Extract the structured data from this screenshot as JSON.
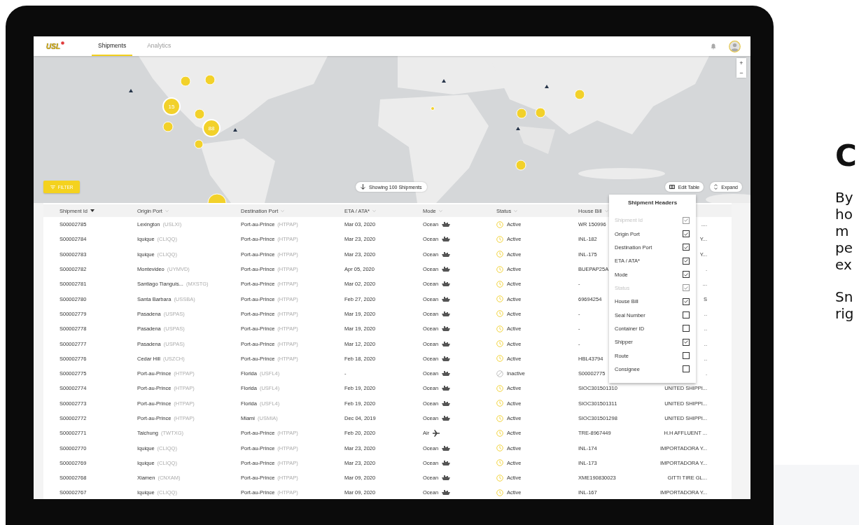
{
  "app": {
    "logo": "USL"
  },
  "tabs": [
    {
      "label": "Shipments",
      "selected": true
    },
    {
      "label": "Analytics",
      "selected": false
    }
  ],
  "map": {
    "kind": "picture",
    "clusters": [
      {
        "label": "15"
      },
      {
        "label": "88"
      }
    ],
    "zoom_controls": [
      "+",
      "−"
    ],
    "filter_button": "FILTER",
    "shipments_pill": "Showing 100 Shipments",
    "edit_table_button": "Edit Table",
    "expand_button": "Expand"
  },
  "table": {
    "columns": [
      {
        "label": "Shipment Id",
        "sorted": true
      },
      {
        "label": "Origin Port",
        "sorted": false
      },
      {
        "label": "Destination Port",
        "sorted": false
      },
      {
        "label": "ETA / ATA*",
        "sorted": false
      },
      {
        "label": "Mode",
        "sorted": false
      },
      {
        "label": "Status",
        "sorted": false
      },
      {
        "label": "House Bill",
        "sorted": false
      }
    ],
    "rows": [
      {
        "id": "S00002785",
        "origin": "Lexington",
        "origin_code": "(USLXI)",
        "destination": "Port-au-Prince",
        "destination_code": "(HTPAP)",
        "eta": "Mar 03, 2020",
        "mode": {
          "label": "Ocean",
          "kind": "ship"
        },
        "status": {
          "label": "Active",
          "kind": "active"
        },
        "house_bill": "WR 150996",
        "column_8": "...."
      },
      {
        "id": "S00002784",
        "origin": "Iquique",
        "origin_code": "(CLIQQ)",
        "destination": "Port-au-Prince",
        "destination_code": "(HTPAP)",
        "eta": "Mar 23, 2020",
        "mode": {
          "label": "Ocean",
          "kind": "ship"
        },
        "status": {
          "label": "Active",
          "kind": "active"
        },
        "house_bill": "INL-182",
        "column_8": "Y..."
      },
      {
        "id": "S00002783",
        "origin": "Iquique",
        "origin_code": "(CLIQQ)",
        "destination": "Port-au-Prince",
        "destination_code": "(HTPAP)",
        "eta": "Mar 23, 2020",
        "mode": {
          "label": "Ocean",
          "kind": "ship"
        },
        "status": {
          "label": "Active",
          "kind": "active"
        },
        "house_bill": "INL-175",
        "column_8": "Y..."
      },
      {
        "id": "S00002782",
        "origin": "Montevideo",
        "origin_code": "(UYMVD)",
        "destination": "Port-au-Prince",
        "destination_code": "(HTPAP)",
        "eta": "Apr 05, 2020",
        "mode": {
          "label": "Ocean",
          "kind": "ship"
        },
        "status": {
          "label": "Active",
          "kind": "active"
        },
        "house_bill": "BUEPAP25A",
        "column_8": "."
      },
      {
        "id": "S00002781",
        "origin": "Santiago Tianguis...",
        "origin_code": "(MXSTG)",
        "destination": "Port-au-Prince",
        "destination_code": "(HTPAP)",
        "eta": "Mar 02, 2020",
        "mode": {
          "label": "Ocean",
          "kind": "ship"
        },
        "status": {
          "label": "Active",
          "kind": "active"
        },
        "house_bill": "-",
        "column_8": "..."
      },
      {
        "id": "S00002780",
        "origin": "Santa Barbara",
        "origin_code": "(USSBA)",
        "destination": "Port-au-Prince",
        "destination_code": "(HTPAP)",
        "eta": "Feb 27, 2020",
        "mode": {
          "label": "Ocean",
          "kind": "ship"
        },
        "status": {
          "label": "Active",
          "kind": "active"
        },
        "house_bill": "69694254",
        "column_8": "S"
      },
      {
        "id": "S00002779",
        "origin": "Pasadena",
        "origin_code": "(USPAS)",
        "destination": "Port-au-Prince",
        "destination_code": "(HTPAP)",
        "eta": "Mar 19, 2020",
        "mode": {
          "label": "Ocean",
          "kind": "ship"
        },
        "status": {
          "label": "Active",
          "kind": "active"
        },
        "house_bill": "-",
        "column_8": ".."
      },
      {
        "id": "S00002778",
        "origin": "Pasadena",
        "origin_code": "(USPAS)",
        "destination": "Port-au-Prince",
        "destination_code": "(HTPAP)",
        "eta": "Mar 19, 2020",
        "mode": {
          "label": "Ocean",
          "kind": "ship"
        },
        "status": {
          "label": "Active",
          "kind": "active"
        },
        "house_bill": "-",
        "column_8": ".."
      },
      {
        "id": "S00002777",
        "origin": "Pasadena",
        "origin_code": "(USPAS)",
        "destination": "Port-au-Prince",
        "destination_code": "(HTPAP)",
        "eta": "Mar 12, 2020",
        "mode": {
          "label": "Ocean",
          "kind": "ship"
        },
        "status": {
          "label": "Active",
          "kind": "active"
        },
        "house_bill": "-",
        "column_8": ".."
      },
      {
        "id": "S00002776",
        "origin": "Cedar Hill",
        "origin_code": "(USZCH)",
        "destination": "Port-au-Prince",
        "destination_code": "(HTPAP)",
        "eta": "Feb 18, 2020",
        "mode": {
          "label": "Ocean",
          "kind": "ship"
        },
        "status": {
          "label": "Active",
          "kind": "active"
        },
        "house_bill": "HBL43794",
        "column_8": ".."
      },
      {
        "id": "S00002775",
        "origin": "Port-au-Prince",
        "origin_code": "(HTPAP)",
        "destination": "Florida",
        "destination_code": "(USFL4)",
        "eta": "-",
        "mode": {
          "label": "Ocean",
          "kind": "ship"
        },
        "status": {
          "label": "Inactive",
          "kind": "inactive"
        },
        "house_bill": "S00002775",
        "column_8": "."
      },
      {
        "id": "S00002774",
        "origin": "Port-au-Prince",
        "origin_code": "(HTPAP)",
        "destination": "Florida",
        "destination_code": "(USFL4)",
        "eta": "Feb 19, 2020",
        "mode": {
          "label": "Ocean",
          "kind": "ship"
        },
        "status": {
          "label": "Active",
          "kind": "active"
        },
        "house_bill": "SIOC301501310",
        "column_8": "UNITED SHIPPI..."
      },
      {
        "id": "S00002773",
        "origin": "Port-au-Prince",
        "origin_code": "(HTPAP)",
        "destination": "Florida",
        "destination_code": "(USFL4)",
        "eta": "Feb 19, 2020",
        "mode": {
          "label": "Ocean",
          "kind": "ship"
        },
        "status": {
          "label": "Active",
          "kind": "active"
        },
        "house_bill": "SIOC301501311",
        "column_8": "UNITED SHIPPI..."
      },
      {
        "id": "S00002772",
        "origin": "Port-au-Prince",
        "origin_code": "(HTPAP)",
        "destination": "Miami",
        "destination_code": "(USMIA)",
        "eta": "Dec 04, 2019",
        "mode": {
          "label": "Ocean",
          "kind": "ship"
        },
        "status": {
          "label": "Active",
          "kind": "active"
        },
        "house_bill": "SIOC301501298",
        "column_8": "UNITED SHIPPI..."
      },
      {
        "id": "S00002771",
        "origin": "Taichung",
        "origin_code": "(TWTXG)",
        "destination": "Port-au-Prince",
        "destination_code": "(HTPAP)",
        "eta": "Feb 20, 2020",
        "mode": {
          "label": "Air",
          "kind": "plane"
        },
        "status": {
          "label": "Active",
          "kind": "active"
        },
        "house_bill": "TRE-8967449",
        "column_8": "H.H AFFLUENT ..."
      },
      {
        "id": "S00002770",
        "origin": "Iquique",
        "origin_code": "(CLIQQ)",
        "destination": "Port-au-Prince",
        "destination_code": "(HTPAP)",
        "eta": "Mar 23, 2020",
        "mode": {
          "label": "Ocean",
          "kind": "ship"
        },
        "status": {
          "label": "Active",
          "kind": "active"
        },
        "house_bill": "INL-174",
        "column_8": "IMPORTADORA Y..."
      },
      {
        "id": "S00002769",
        "origin": "Iquique",
        "origin_code": "(CLIQQ)",
        "destination": "Port-au-Prince",
        "destination_code": "(HTPAP)",
        "eta": "Mar 23, 2020",
        "mode": {
          "label": "Ocean",
          "kind": "ship"
        },
        "status": {
          "label": "Active",
          "kind": "active"
        },
        "house_bill": "INL-173",
        "column_8": "IMPORTADORA Y..."
      },
      {
        "id": "S00002768",
        "origin": "Xiamen",
        "origin_code": "(CNXAM)",
        "destination": "Port-au-Prince",
        "destination_code": "(HTPAP)",
        "eta": "Mar 09, 2020",
        "mode": {
          "label": "Ocean",
          "kind": "ship"
        },
        "status": {
          "label": "Active",
          "kind": "active"
        },
        "house_bill": "XME190830023",
        "column_8": "GITTI TIRE GL..."
      },
      {
        "id": "S00002767",
        "origin": "Iquique",
        "origin_code": "(CLIQQ)",
        "destination": "Port-au-Prince",
        "destination_code": "(HTPAP)",
        "eta": "Mar 09, 2020",
        "mode": {
          "label": "Ocean",
          "kind": "ship"
        },
        "status": {
          "label": "Active",
          "kind": "active"
        },
        "house_bill": "INL-167",
        "column_8": "IMPORTADORA Y..."
      }
    ]
  },
  "headers_menu": {
    "title": "Shipment Headers",
    "items": [
      {
        "label": "Shipment Id",
        "checked": true,
        "disabled": true
      },
      {
        "label": "Origin Port",
        "checked": true,
        "disabled": false
      },
      {
        "label": "Destination Port",
        "checked": true,
        "disabled": false
      },
      {
        "label": "ETA / ATA*",
        "checked": true,
        "disabled": false
      },
      {
        "label": "Mode",
        "checked": true,
        "disabled": false
      },
      {
        "label": "Status",
        "checked": true,
        "disabled": true
      },
      {
        "label": "House Bill",
        "checked": true,
        "disabled": false
      },
      {
        "label": "Seal Number",
        "checked": false,
        "disabled": false
      },
      {
        "label": "Container ID",
        "checked": false,
        "disabled": false
      },
      {
        "label": "Shipper",
        "checked": true,
        "disabled": false
      },
      {
        "label": "Route",
        "checked": false,
        "disabled": false
      },
      {
        "label": "Consignee",
        "checked": false,
        "disabled": false
      }
    ]
  },
  "side_text": {
    "heading": "C",
    "paragraphs": [
      [
        "By",
        "ho",
        "m",
        "pe",
        "ex"
      ],
      [
        "Sn",
        "rig"
      ]
    ]
  }
}
